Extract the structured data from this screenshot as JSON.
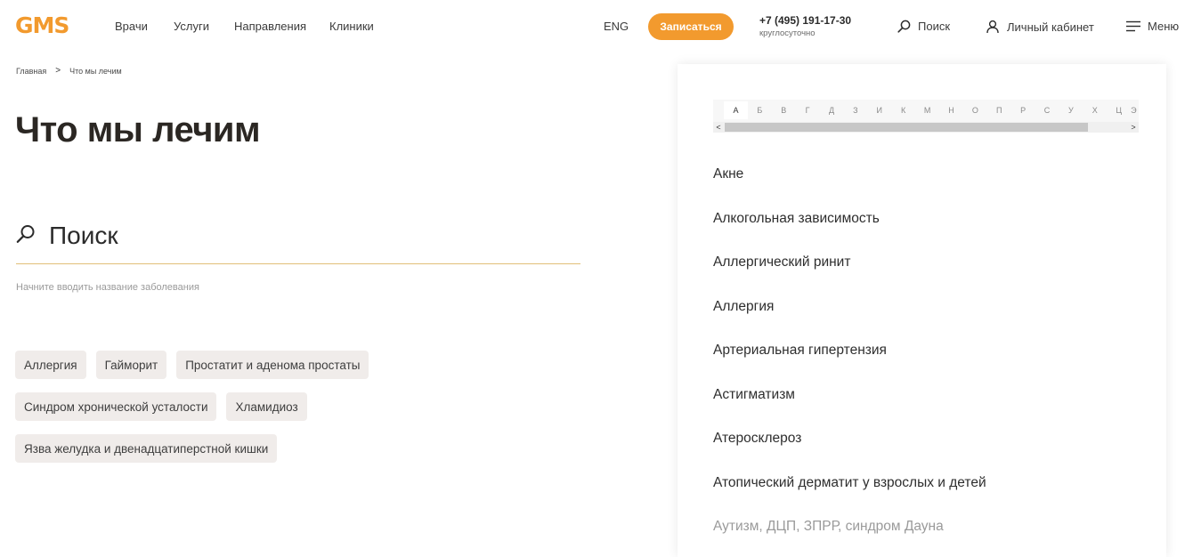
{
  "header": {
    "logo": "GMS",
    "nav": [
      "Врачи",
      "Услуги",
      "Направления",
      "Клиники"
    ],
    "lang": "ENG",
    "cta": "Записаться",
    "phone": "+7 (495) 191-17-30",
    "phone_note": "круглосуточно",
    "search_label": "Поиск",
    "account_label": "Личный кабинет",
    "menu_label": "Меню"
  },
  "breadcrumb": {
    "home": "Главная",
    "separator": ">",
    "current": "Что мы лечим"
  },
  "page": {
    "title": "Что мы лечим"
  },
  "search": {
    "placeholder": "Поиск",
    "hint": "Начните вводить название заболевания"
  },
  "tags": [
    "Аллергия",
    "Гайморит",
    "Простатит и аденома простаты",
    "Синдром хронической усталости",
    "Хламидиоз",
    "Язва желудка и двенадцатиперстной кишки"
  ],
  "alphabet": {
    "letters": [
      "А",
      "Б",
      "В",
      "Г",
      "Д",
      "З",
      "И",
      "К",
      "М",
      "Н",
      "О",
      "П",
      "Р",
      "С",
      "У",
      "Х",
      "Ц",
      "Э"
    ],
    "active": "А",
    "scroll_left": "<",
    "scroll_right": ">"
  },
  "diseases": [
    "Акне",
    "Алкогольная зависимость",
    "Аллергический ринит",
    "Аллергия",
    "Артериальная гипертензия",
    "Астигматизм",
    "Атеросклероз",
    "Атопический дерматит у взрослых и детей",
    "Аутизм, ДЦП, ЗПРР, синдром Дауна"
  ],
  "colors": {
    "accent": "#f29a2e",
    "search_underline": "#e1bf78",
    "tag_bg": "#f0ecea"
  },
  "icons": {
    "search": "search-icon",
    "account": "user-icon",
    "menu": "hamburger-icon",
    "breadcrumb_separator": "chevron-right-icon"
  }
}
